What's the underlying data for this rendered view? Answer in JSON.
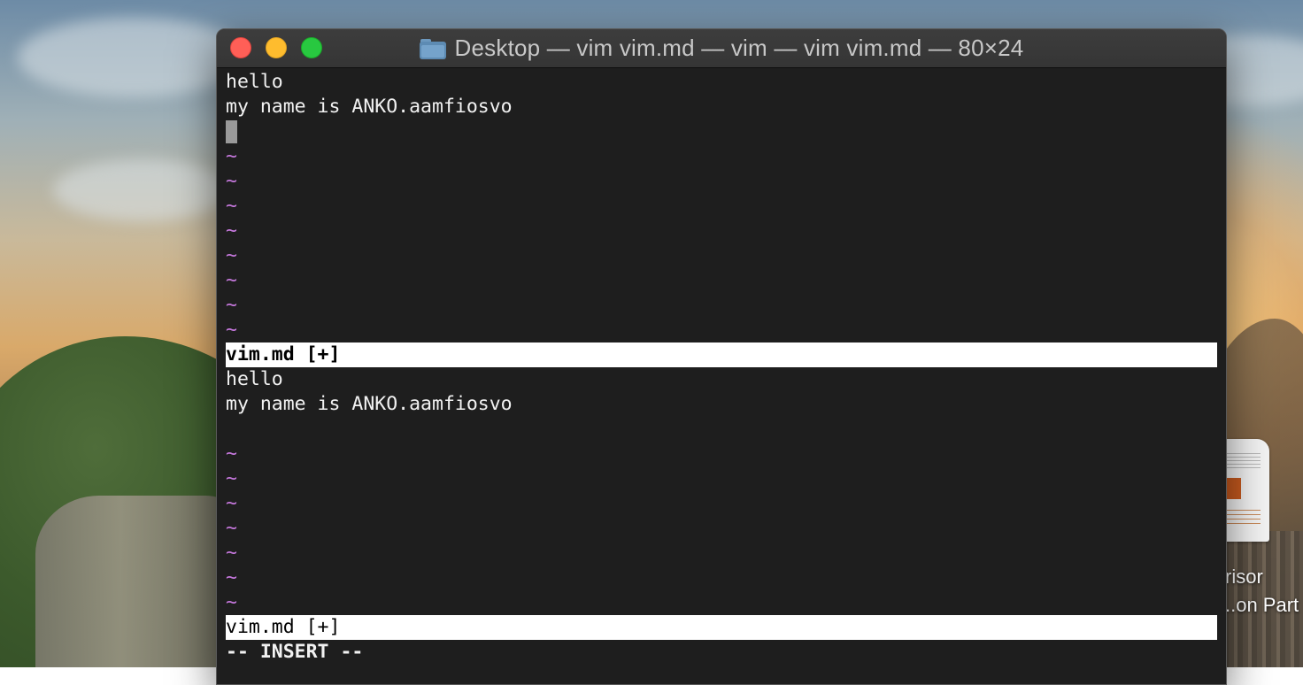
{
  "window": {
    "title": "Desktop — vim vim.md — vim — vim vim.md — 80×24",
    "folder_icon": "folder-icon"
  },
  "top_pane": {
    "lines": [
      "hello",
      "my name is ANKO.aamfiosvo",
      ""
    ],
    "tilde": "~",
    "status_line": "vim.md [+]"
  },
  "bottom_pane": {
    "lines": [
      "hello",
      "my name is ANKO.aamfiosvo",
      ""
    ],
    "tilde": "~",
    "status_line": "vim.md [+]"
  },
  "mode_line": "-- INSERT --",
  "desktop_file": {
    "label_line1": "risor",
    "label_line2": "..on Part"
  },
  "colors": {
    "terminal_bg": "#1e1e1e",
    "text": "#f2f2f2",
    "tilde": "#c678dd",
    "status_bg": "#ffffff"
  }
}
